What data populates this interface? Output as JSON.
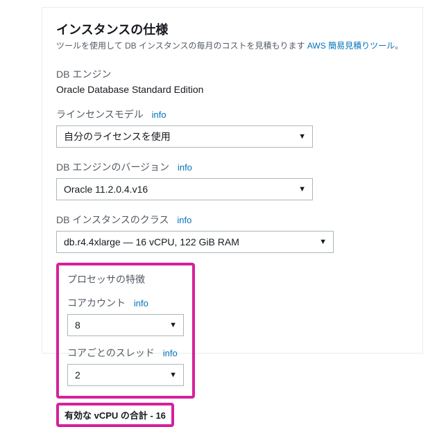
{
  "heading": "インスタンスの仕様",
  "subheading_prefix": "ツールを使用して DB インスタンスの毎月のコストを見積もります ",
  "subheading_link": "AWS 簡易見積りツール",
  "subheading_suffix": "。",
  "db_engine": {
    "label": "DB エンジン",
    "value": "Oracle Database Standard Edition"
  },
  "license_model": {
    "label": "ラインセンスモデル",
    "info": "info",
    "selected": "自分のライセンスを使用"
  },
  "engine_version": {
    "label": "DB エンジンのバージョン",
    "info": "info",
    "selected": "Oracle 11.2.0.4.v16"
  },
  "instance_class": {
    "label": "DB インスタンスのクラス",
    "info": "info",
    "selected": "db.r4.4xlarge — 16 vCPU, 122 GiB RAM"
  },
  "processor": {
    "title": "プロセッサの特徴",
    "core_count": {
      "label": "コアカウント",
      "info": "info",
      "selected": "8"
    },
    "threads_per_core": {
      "label": "コアごとのスレッド",
      "info": "info",
      "selected": "2"
    }
  },
  "vcpu_total": "有効な vCPU の合計 - 16"
}
